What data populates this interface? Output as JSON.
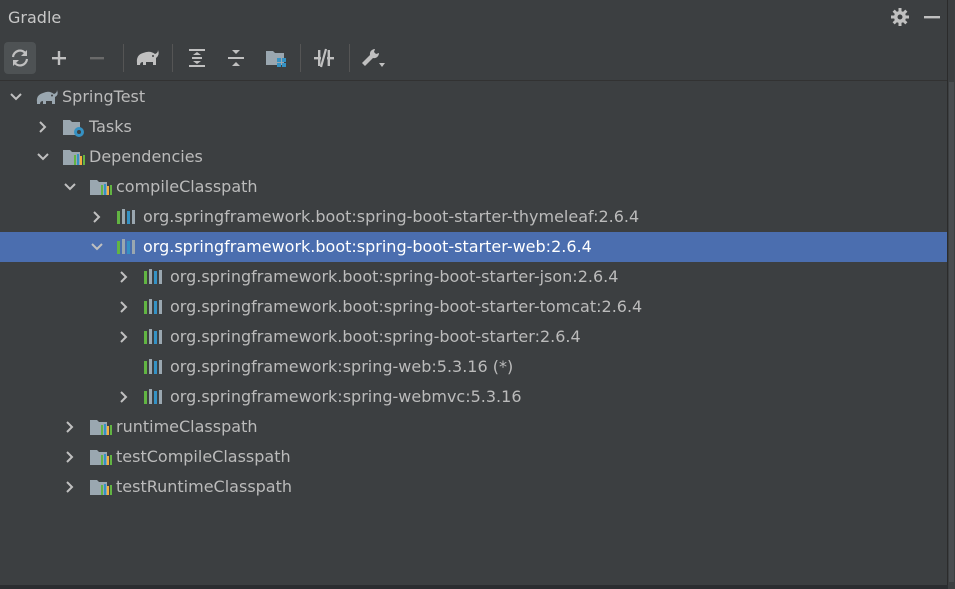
{
  "header": {
    "title": "Gradle"
  },
  "toolbar": {
    "buttons": [
      {
        "name": "reload-all-gradle-projects-icon"
      },
      {
        "name": "add-icon"
      },
      {
        "name": "remove-icon"
      },
      {
        "name": "gradle-elephant-icon"
      },
      {
        "name": "expand-all-icon"
      },
      {
        "name": "collapse-all-icon"
      },
      {
        "name": "group-modules-icon"
      },
      {
        "name": "toggle-offline-icon"
      },
      {
        "name": "build-tool-settings-icon"
      }
    ]
  },
  "tree": {
    "rows": [
      {
        "label": "SpringTest",
        "indent": 0,
        "expanded": true,
        "icon": "gradle"
      },
      {
        "label": "Tasks",
        "indent": 1,
        "expanded": false,
        "icon": "tasks-folder"
      },
      {
        "label": "Dependencies",
        "indent": 1,
        "expanded": true,
        "icon": "deps-folder"
      },
      {
        "label": "compileClasspath",
        "indent": 2,
        "expanded": true,
        "icon": "deps-folder"
      },
      {
        "label": "org.springframework.boot:spring-boot-starter-thymeleaf:2.6.4",
        "indent": 3,
        "expanded": false,
        "icon": "library"
      },
      {
        "label": "org.springframework.boot:spring-boot-starter-web:2.6.4",
        "indent": 3,
        "expanded": true,
        "icon": "library",
        "selected": true
      },
      {
        "label": "org.springframework.boot:spring-boot-starter-json:2.6.4",
        "indent": 4,
        "expanded": false,
        "icon": "library"
      },
      {
        "label": "org.springframework.boot:spring-boot-starter-tomcat:2.6.4",
        "indent": 4,
        "expanded": false,
        "icon": "library"
      },
      {
        "label": "org.springframework.boot:spring-boot-starter:2.6.4",
        "indent": 4,
        "expanded": false,
        "icon": "library"
      },
      {
        "label": "org.springframework:spring-web:5.3.16 (*)",
        "indent": 4,
        "expanded": null,
        "icon": "library"
      },
      {
        "label": "org.springframework:spring-webmvc:5.3.16",
        "indent": 4,
        "expanded": false,
        "icon": "library"
      },
      {
        "label": "runtimeClasspath",
        "indent": 2,
        "expanded": false,
        "icon": "deps-folder"
      },
      {
        "label": "testCompileClasspath",
        "indent": 2,
        "expanded": false,
        "icon": "deps-folder"
      },
      {
        "label": "testRuntimeClasspath",
        "indent": 2,
        "expanded": false,
        "icon": "deps-folder"
      }
    ]
  },
  "colors": {
    "background": "#3c3f41",
    "selection": "#4b6eaf",
    "text": "#bbbbbb",
    "library_icon": "#62b543"
  }
}
